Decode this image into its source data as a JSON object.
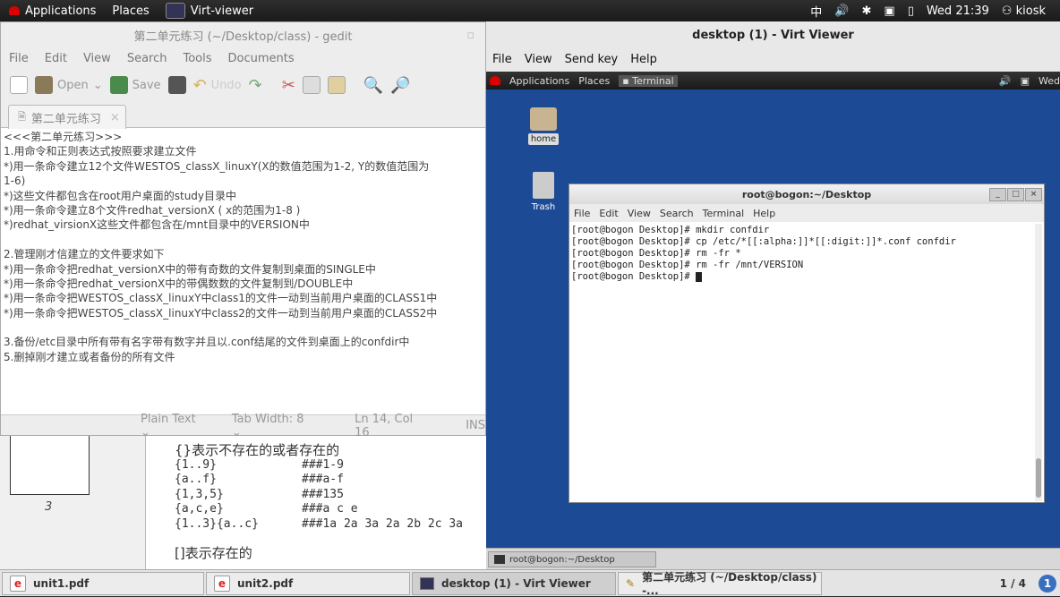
{
  "topbar": {
    "applications": "Applications",
    "places": "Places",
    "active_app": "Virt-viewer",
    "input_method": "中",
    "clock": "Wed 21:39",
    "user": "kiosk"
  },
  "gedit": {
    "title": "第二单元练习 (~/Desktop/class) - gedit",
    "menu": [
      "File",
      "Edit",
      "View",
      "Search",
      "Tools",
      "Documents"
    ],
    "toolbar": {
      "open": "Open",
      "save": "Save",
      "undo": "Undo"
    },
    "tab": "第二单元练习",
    "lines": [
      "<<<第二单元练习>>>",
      "1.用命令和正则表达式按照要求建立文件",
      "*)用一条命令建立12个文件WESTOS_classX_linuxY(X的数值范围为1-2, Y的数值范围为",
      "1-6)",
      "*)这些文件都包含在root用户桌面的study目录中",
      "*)用一条命令建立8个文件redhat_versionX ( x的范围为1-8 )",
      "*)redhat_virsionX这些文件都包含在/mnt目录中的VERSION中",
      "",
      "2.管理刚才信建立的文件要求如下",
      "*)用一条命令把redhat_versionX中的带有奇数的文件复制到桌面的SINGLE中",
      "*)用一条命令把redhat_versionX中的带偶数数的文件复制到/DOUBLE中",
      "*)用一条命令把WESTOS_classX_linuxY中class1的文件一动到当前用户桌面的CLASS1中",
      "*)用一条命令把WESTOS_classX_linuxY中class2的文件一动到当前用户桌面的CLASS2中",
      "",
      "3.备份/etc目录中所有带有名字带有数字并且以.conf结尾的文件到桌面上的confdir中",
      "5.删掉刚才建立或者备份的所有文件"
    ],
    "status": {
      "lang": "Plain Text",
      "tab_width": "Tab Width:  8",
      "position": "Ln 14, Col 16",
      "mode": "INS"
    }
  },
  "evince": {
    "page_label": "3",
    "heading1": "{}表示不存在的或者存在的",
    "heading2": "[]表示存在的",
    "rows": [
      {
        "a": "{1..9}",
        "b": "###1-9"
      },
      {
        "a": "{a..f}",
        "b": "###a-f"
      },
      {
        "a": "{1,3,5}",
        "b": "###135"
      },
      {
        "a": "{a,c,e}",
        "b": "###a c e"
      },
      {
        "a": "{1..3}{a..c}",
        "b": "###1a 2a 3a 2a 2b 2c 3a"
      }
    ]
  },
  "virt": {
    "title": "desktop (1) - Virt Viewer",
    "menu": [
      "File",
      "View",
      "Send key",
      "Help"
    ],
    "guest": {
      "applications": "Applications",
      "places": "Places",
      "terminal_tab": "Terminal",
      "day": "Wed",
      "icons": {
        "home": "home",
        "trash": "Trash"
      },
      "terminal": {
        "title": "root@bogon:~/Desktop",
        "menu": [
          "File",
          "Edit",
          "View",
          "Search",
          "Terminal",
          "Help"
        ],
        "lines": [
          "[root@bogon Desktop]# mkdir confdir",
          "[root@bogon Desktop]# cp /etc/*[[:alpha:]]*[[:digit:]]*.conf confdir",
          "[root@bogon Desktop]# rm -fr *",
          "[root@bogon Desktop]# rm -fr /mnt/VERSION",
          "[root@bogon Desktop]# "
        ]
      },
      "task": "root@bogon:~/Desktop"
    }
  },
  "taskbar": {
    "tasks": [
      "unit1.pdf",
      "unit2.pdf",
      "desktop (1) - Virt Viewer",
      "第二单元练习 (~/Desktop/class) -..."
    ],
    "workspace": "1 / 4"
  }
}
